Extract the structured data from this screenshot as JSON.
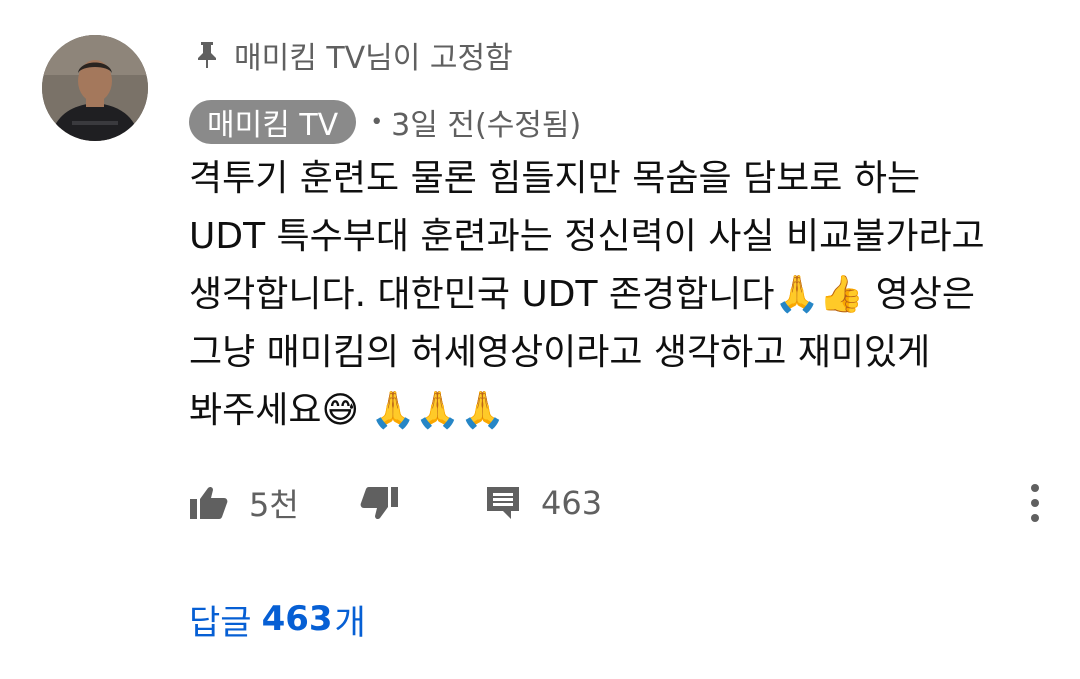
{
  "pinned": {
    "icon": "pin-icon",
    "text": "매미킴 TV님이 고정함"
  },
  "comment": {
    "channel_badge": "매미킴 TV",
    "separator": "•",
    "time": "3일 전(수정됨)",
    "lines": [
      "격투기 훈련도 물론 힘들지만 목숨을 담보로 하는",
      "UDT 특수부대 훈련과는 정신력이 사실 비교불가라고",
      "생각합니다. 대한민국 UDT 존경합니다🙏👍 영상은",
      "그냥 매미킴의 허세영상이라고 생각하고 재미있게",
      "봐주세요😅 🙏🙏🙏"
    ]
  },
  "actions": {
    "like_count": "5천",
    "reply_count": "463"
  },
  "replies": {
    "prefix": "답글",
    "count": "463",
    "suffix": "개"
  },
  "colors": {
    "secondary_text": "#606060",
    "badge_bg": "#8a8a8a",
    "link_blue": "#065fd4"
  }
}
